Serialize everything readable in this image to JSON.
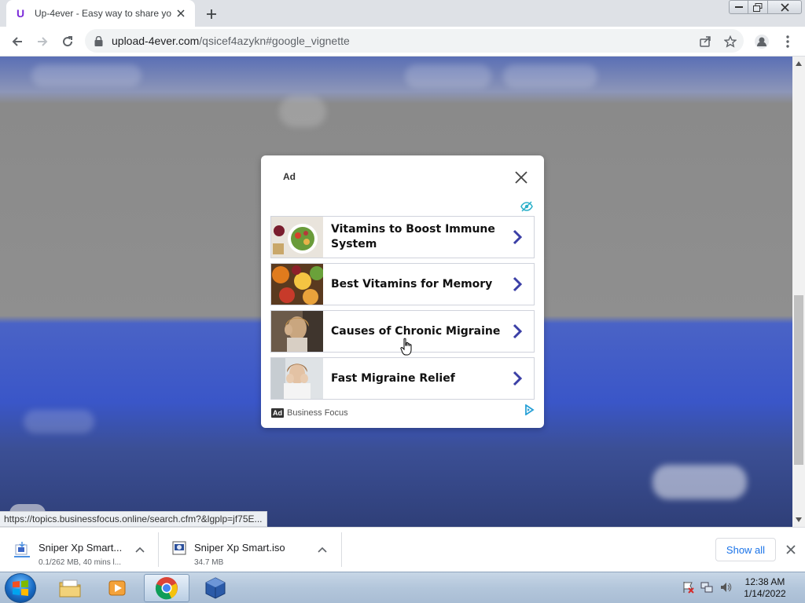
{
  "browser": {
    "tab": {
      "title": "Up-4ever - Easy way to share yo",
      "favicon_letter": "U"
    },
    "url": {
      "host": "upload-4ever.com",
      "path": "/qsicef4azykn#google_vignette"
    },
    "status_url": "https://topics.businessfocus.online/search.cfm?&lgplp=jf75E..."
  },
  "ad": {
    "header_label": "Ad",
    "items": [
      {
        "title": "Vitamins to Boost Immune System"
      },
      {
        "title": "Best Vitamins for Memory"
      },
      {
        "title": "Causes of Chronic Migraine"
      },
      {
        "title": "Fast Migraine Relief"
      }
    ],
    "footer_badge": "Ad",
    "footer_brand": "Business Focus",
    "colors": {
      "chevron": "#3b3fa6",
      "eye": "#2bb0c9",
      "adchoices": "#27a0d6"
    }
  },
  "downloads": {
    "items": [
      {
        "name": "Sniper Xp Smart...",
        "status": "0.1/262 MB, 40 mins l..."
      },
      {
        "name": "Sniper Xp Smart.iso",
        "status": "34.7 MB"
      }
    ],
    "show_all_label": "Show all"
  },
  "taskbar": {
    "apps": [
      "folder-icon",
      "media-player-icon",
      "chrome-icon",
      "virtualbox-icon"
    ],
    "clock_time": "12:38 AM",
    "clock_date": "1/14/2022"
  }
}
